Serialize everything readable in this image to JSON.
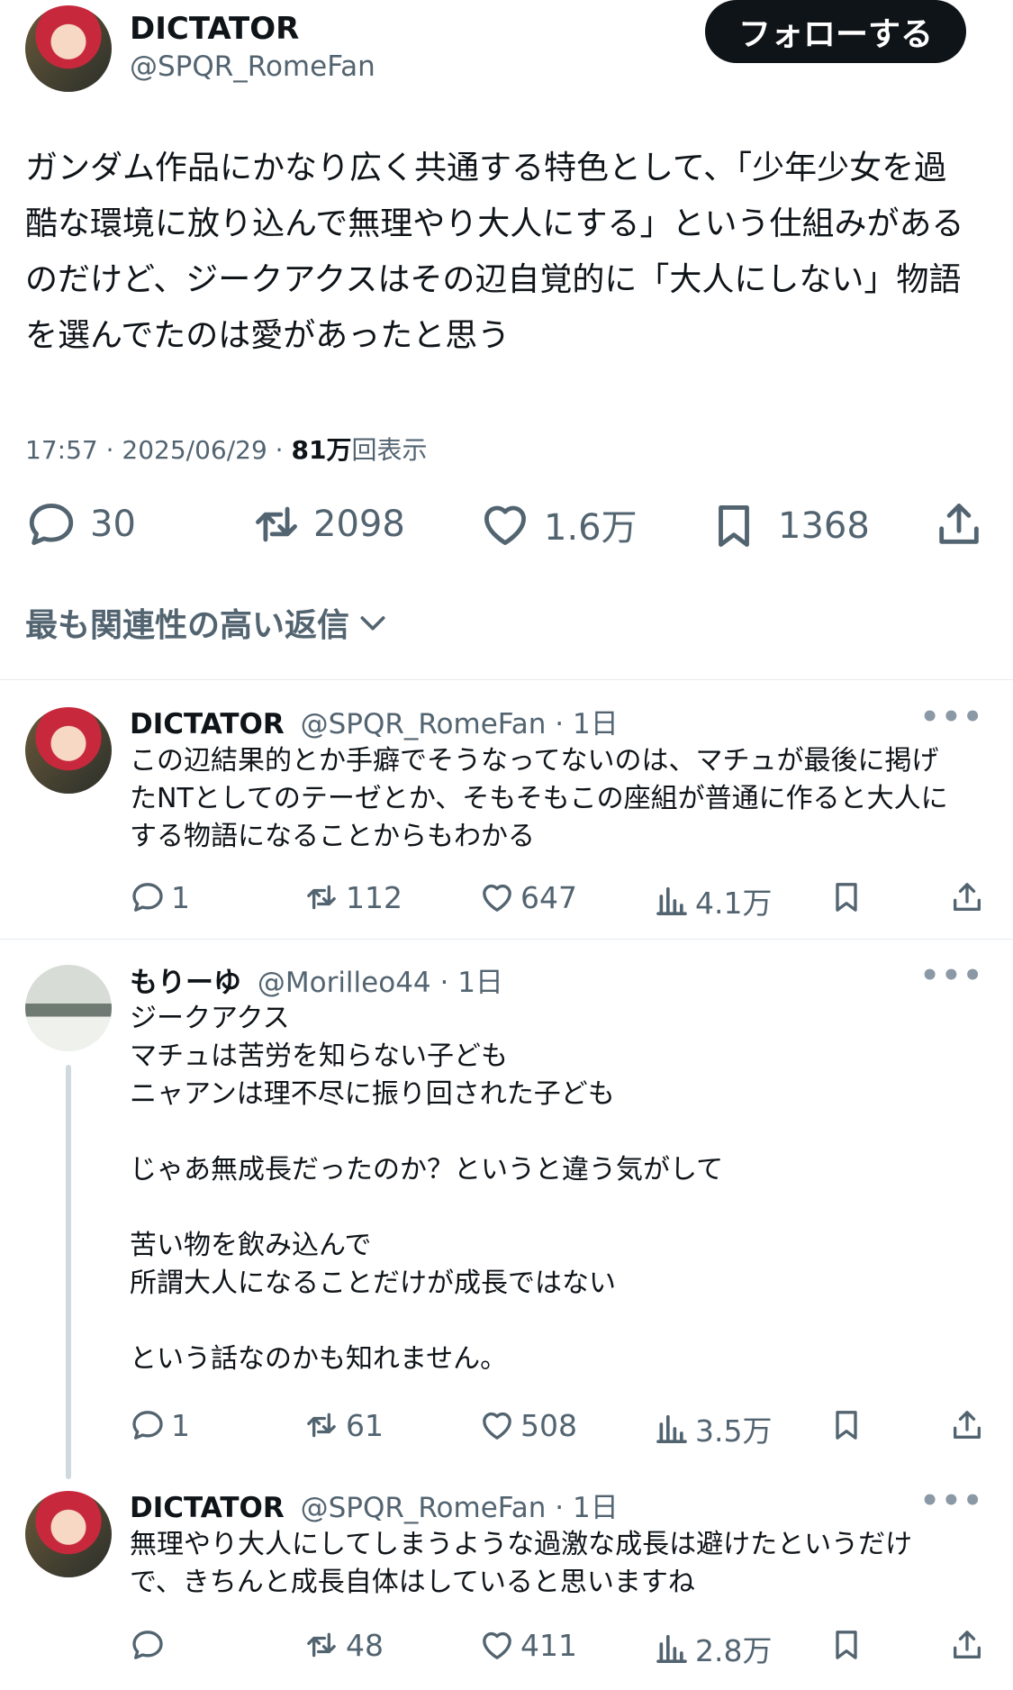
{
  "main_post": {
    "display_name": "DICTATOR",
    "handle": "@SPQR_RomeFan",
    "follow_label": "フォローする",
    "text_lines": [
      "ガンダム作品にかなり広く共通する特色として、「少年少女を過",
      "酷な環境に放り込んで無理やり大人にする」という仕組みがある",
      "のだけど、ジークアクスはその辺自覚的に「大人にしない」物語",
      "を選んでたのは愛があったと思う"
    ],
    "time": "17:57 · 2025/06/29 · ",
    "views_count": "81万",
    "views_suffix": "回表示",
    "replies": "30",
    "reposts": "2098",
    "likes": "1.6万",
    "bookmarks": "1368"
  },
  "sort": {
    "label": "最も関連性の高い返信"
  },
  "replies": [
    {
      "display_name": "DICTATOR",
      "handle": "@SPQR_RomeFan · 1日",
      "text": "この辺結果的とか手癖でそうなってないのは、マチュが最後に掲げ\nたNTとしてのテーゼとか、そもそもこの座組が普通に作ると大人に\nする物語になることからもわかる",
      "replies": "1",
      "reposts": "112",
      "likes": "647",
      "views": "4.1万"
    },
    {
      "display_name": "もりーゆ",
      "handle": "@Morilleo44 · 1日",
      "text": "ジークアクス\nマチュは苦労を知らない子ども\nニャアンは理不尽に振り回された子ども\n\nじゃあ無成長だったのか？というと違う気がして\n\n苦い物を飲み込んで\n所謂大人になることだけが成長ではない\n\nという話なのかも知れません。",
      "replies": "1",
      "reposts": "61",
      "likes": "508",
      "views": "3.5万"
    },
    {
      "display_name": "DICTATOR",
      "handle": "@SPQR_RomeFan · 1日",
      "text": "無理やり大人にしてしまうような過激な成長は避けたというだけ\nで、きちんと成長自体はしていると思いますね",
      "replies": "",
      "reposts": "48",
      "likes": "411",
      "views": "2.8万"
    }
  ]
}
